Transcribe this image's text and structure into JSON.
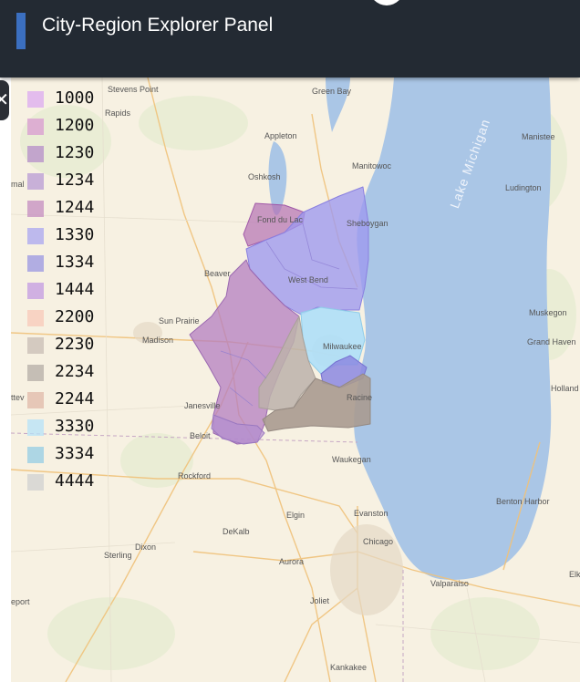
{
  "header": {
    "title": "City-Region Explorer Panel"
  },
  "colors": {
    "header_bg": "#232a33",
    "accent": "#3b6fc0",
    "lake": "#aac6e6",
    "land": "#f7f1e2"
  },
  "legend": [
    {
      "label": "1000",
      "color": "#dcaaf0"
    },
    {
      "label": "1200",
      "color": "#d89ad0"
    },
    {
      "label": "1230",
      "color": "#b48cc8"
    },
    {
      "label": "1234",
      "color": "#b89ad4"
    },
    {
      "label": "1244",
      "color": "#c48cc0"
    },
    {
      "label": "1330",
      "color": "#aaa6f0"
    },
    {
      "label": "1334",
      "color": "#9a96e2"
    },
    {
      "label": "1444",
      "color": "#c39ae2"
    },
    {
      "label": "2200",
      "color": "#f8c8b8"
    },
    {
      "label": "2230",
      "color": "#c8bcb4"
    },
    {
      "label": "2234",
      "color": "#b4aca6"
    },
    {
      "label": "2244",
      "color": "#e0b8a8"
    },
    {
      "label": "3330",
      "color": "#b6e2f8"
    },
    {
      "label": "3334",
      "color": "#94cce4"
    },
    {
      "label": "4444",
      "color": "#d0d0d0"
    }
  ],
  "map_labels": {
    "stevens_point": "Stevens Point",
    "green_bay": "Green Bay",
    "rapids": "Rapids",
    "appleton": "Appleton",
    "manistee": "Manistee",
    "oshkosh": "Oshkosh",
    "manitowoc": "Manitowoc",
    "ludington": "Ludington",
    "fond_du_lac": "Fond du Lac",
    "sheboygan": "Sheboygan",
    "beaver_dam": "Beaver",
    "west_bend": "West Bend",
    "muskegon": "Muskegon",
    "sun_prairie": "Sun Prairie",
    "madison": "Madison",
    "milwaukee": "Milwaukee",
    "grand_haven": "Grand Haven",
    "holland": "Holland",
    "janesville": "Janesville",
    "racine": "Racine",
    "beloit": "Beloit",
    "waukegan": "Waukegan",
    "rockford": "Rockford",
    "benton_harbor": "Benton Harbor",
    "elgin": "Elgin",
    "evanston": "Evanston",
    "dekalb": "DeKalb",
    "chicago": "Chicago",
    "dixon": "Dixon",
    "sterling": "Sterling",
    "aurora": "Aurora",
    "elk": "Elk",
    "freeport": "eport",
    "joliet": "Joliet",
    "valparaiso": "Valparaiso",
    "kankakee": "Kankakee",
    "lake_michigan": "Lake Michigan",
    "left_mal": "mal",
    "left_atte": "ttev"
  }
}
